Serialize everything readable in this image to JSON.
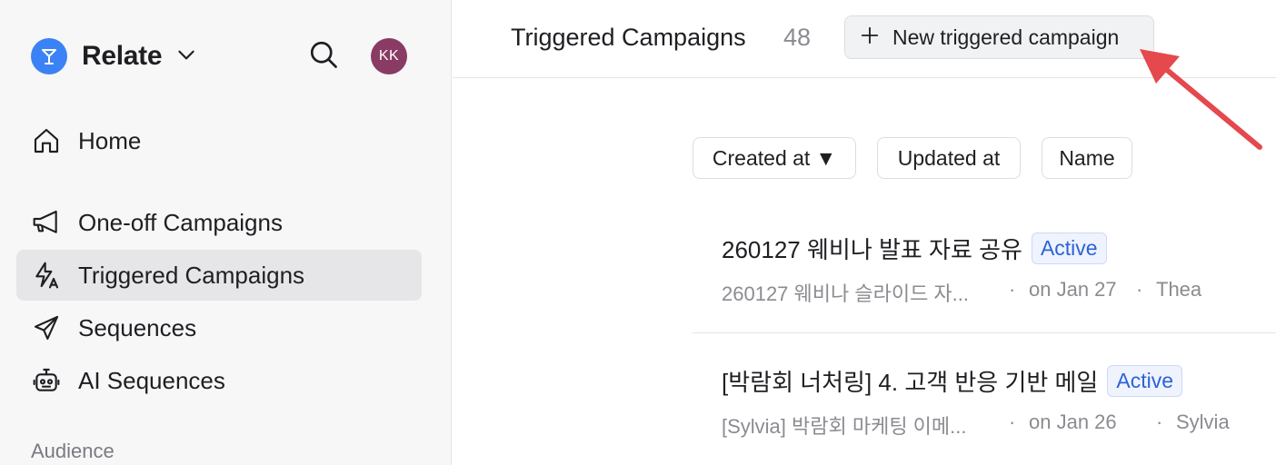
{
  "sidebar": {
    "brand": {
      "name": "Relate",
      "logo_icon": "relate-logo-icon",
      "chevron_icon": "chevron-down-icon"
    },
    "search_icon": "search-icon",
    "avatar": {
      "initials": "KK",
      "color": "#8a3b63"
    },
    "nav": [
      {
        "label": "Home",
        "icon": "home-icon",
        "active": false
      },
      {
        "label": "One-off Campaigns",
        "icon": "megaphone-icon",
        "active": false
      },
      {
        "label": "Triggered Campaigns",
        "icon": "lightning-icon",
        "active": true
      },
      {
        "label": "Sequences",
        "icon": "paper-plane-icon",
        "active": false
      },
      {
        "label": "AI Sequences",
        "icon": "robot-icon",
        "active": false
      }
    ],
    "section_label": "Audience"
  },
  "header": {
    "title": "Triggered Campaigns",
    "count": "48",
    "new_button_label": "New triggered campaign",
    "new_button_icon": "plus-icon"
  },
  "sort": {
    "created_label": "Created at",
    "created_indicator": "▼",
    "updated_label": "Updated at",
    "name_label": "Name"
  },
  "campaigns": [
    {
      "title": "260127 웨비나 발표 자료 공유",
      "status": "Active",
      "subtitle": "260127 웨비나 슬라이드 자...",
      "date": "on Jan 27",
      "author": "Thea"
    },
    {
      "title": "[박람회 너처링] 4. 고객 반응 기반 메일",
      "status": "Active",
      "subtitle": "[Sylvia] 박람회 마케팅 이메...",
      "date": "on Jan 26",
      "author": "Sylvia"
    }
  ],
  "colors": {
    "accent": "#3b82f6",
    "badge_text": "#2e63d6",
    "annotation_arrow": "#e5484d"
  }
}
